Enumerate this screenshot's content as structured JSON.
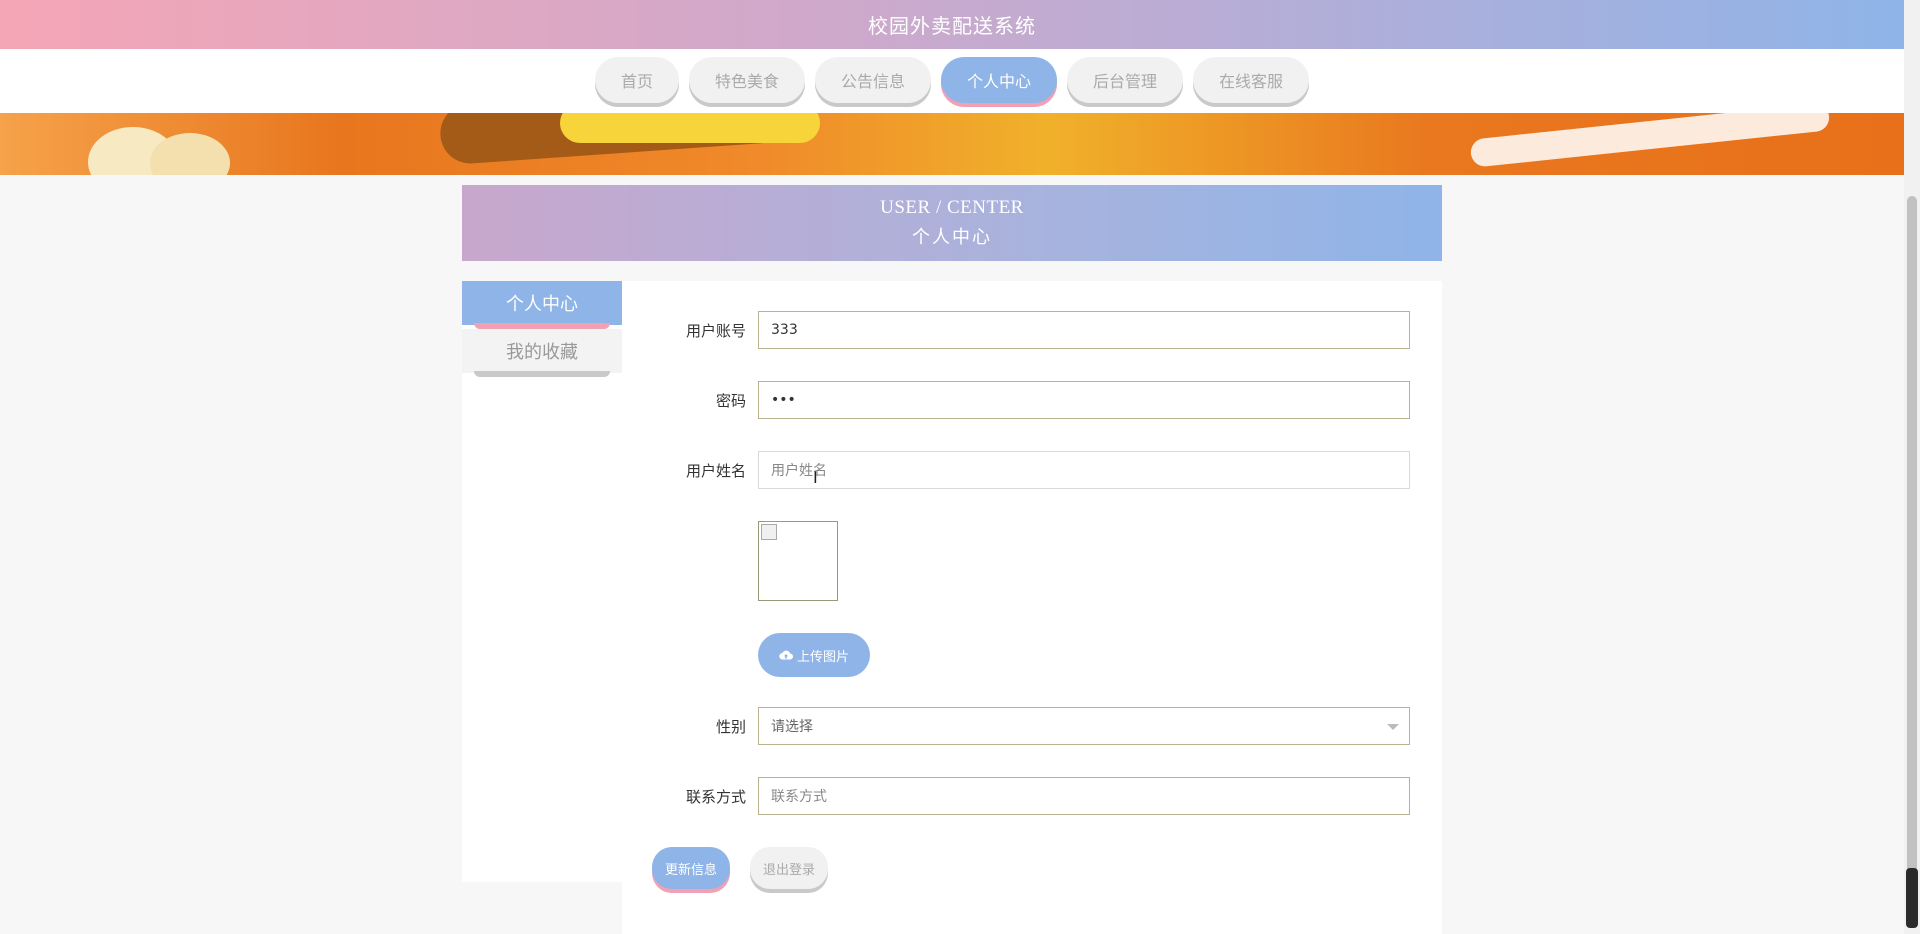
{
  "header": {
    "title": "校园外卖配送系统"
  },
  "nav": {
    "items": [
      {
        "label": "首页",
        "active": false
      },
      {
        "label": "特色美食",
        "active": false
      },
      {
        "label": "公告信息",
        "active": false
      },
      {
        "label": "个人中心",
        "active": true
      },
      {
        "label": "后台管理",
        "active": false
      },
      {
        "label": "在线客服",
        "active": false
      }
    ]
  },
  "center_header": {
    "en": "USER / CENTER",
    "cn": "个人中心"
  },
  "sidebar": {
    "items": [
      {
        "label": "个人中心",
        "active": true
      },
      {
        "label": "我的收藏",
        "active": false
      }
    ]
  },
  "form": {
    "account": {
      "label": "用户账号",
      "value": "333"
    },
    "password": {
      "label": "密码",
      "value": "•••"
    },
    "name": {
      "label": "用户姓名",
      "placeholder": "用户姓名"
    },
    "upload": {
      "label": "上传图片",
      "icon": "cloud-upload-icon"
    },
    "gender": {
      "label": "性别",
      "selected": "请选择"
    },
    "contact": {
      "label": "联系方式",
      "placeholder": "联系方式"
    }
  },
  "actions": {
    "update": "更新信息",
    "logout": "退出登录"
  },
  "colors": {
    "accent": "#8fb4e8",
    "pink": "#f2a0b4",
    "header_gradient_start": "#f5a6b6"
  }
}
